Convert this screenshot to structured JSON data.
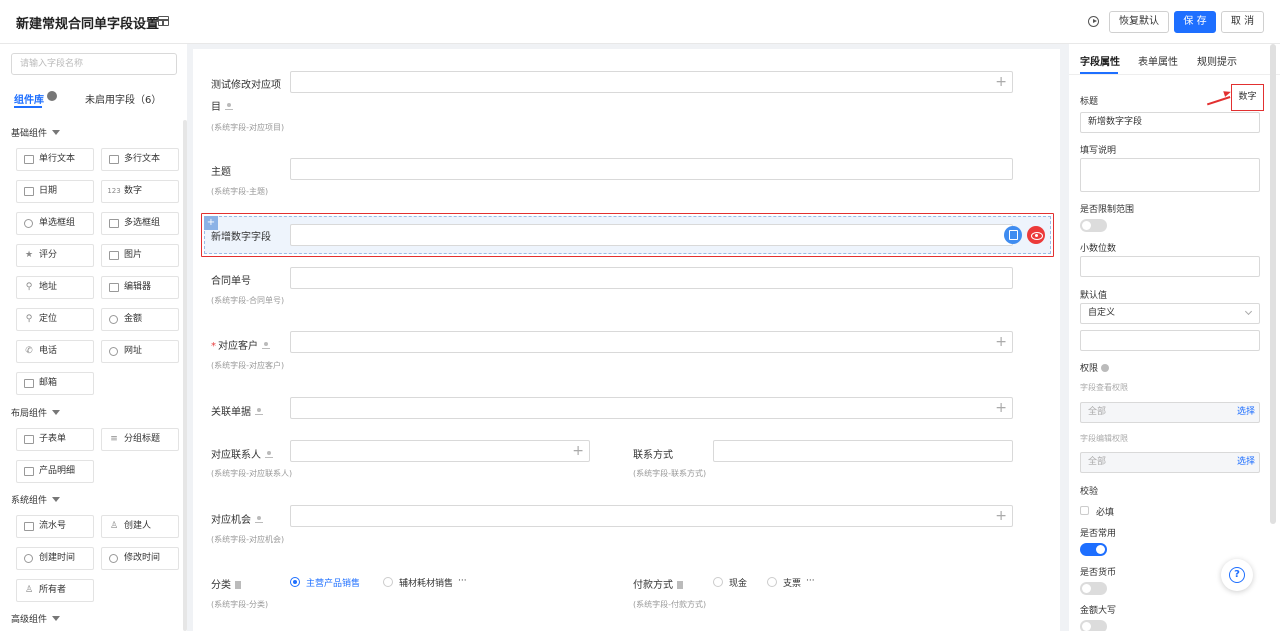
{
  "header": {
    "title": "新建常规合同单字段设置",
    "restore_label": "恢复默认",
    "save_label": "保 存",
    "cancel_label": "取 消"
  },
  "left_panel": {
    "search_placeholder": "请输入字段名称",
    "tabs": {
      "library": "组件库",
      "unused": "未启用字段（6）"
    },
    "groups": [
      {
        "title": "基础组件",
        "items": [
          {
            "label": "单行文本",
            "icon": "single-line-icon"
          },
          {
            "label": "多行文本",
            "icon": "multi-line-icon"
          },
          {
            "label": "日期",
            "icon": "calendar-icon"
          },
          {
            "label": "数字",
            "icon": "number-icon",
            "glyph": "123"
          },
          {
            "label": "单选框组",
            "icon": "radio-icon"
          },
          {
            "label": "多选框组",
            "icon": "checkbox-icon"
          },
          {
            "label": "评分",
            "icon": "star-icon",
            "glyph": "★"
          },
          {
            "label": "图片",
            "icon": "image-icon"
          },
          {
            "label": "地址",
            "icon": "location-icon",
            "glyph": "⚲"
          },
          {
            "label": "编辑器",
            "icon": "editor-icon"
          },
          {
            "label": "定位",
            "icon": "pin-icon",
            "glyph": "⚲"
          },
          {
            "label": "金额",
            "icon": "coin-icon"
          },
          {
            "label": "电话",
            "icon": "phone-icon",
            "glyph": "✆"
          },
          {
            "label": "网址",
            "icon": "link-icon"
          },
          {
            "label": "邮箱",
            "icon": "mail-icon"
          }
        ]
      },
      {
        "title": "布局组件",
        "items": [
          {
            "label": "子表单",
            "icon": "subform-icon"
          },
          {
            "label": "分组标题",
            "icon": "group-title-icon",
            "glyph": "≡"
          },
          {
            "label": "产品明细",
            "icon": "product-detail-icon"
          }
        ]
      },
      {
        "title": "系统组件",
        "items": [
          {
            "label": "流水号",
            "icon": "serial-icon"
          },
          {
            "label": "创建人",
            "icon": "user-icon",
            "glyph": "♙"
          },
          {
            "label": "创建时间",
            "icon": "clock-icon"
          },
          {
            "label": "修改时间",
            "icon": "clock-edit-icon"
          },
          {
            "label": "所有者",
            "icon": "owner-icon",
            "glyph": "♙"
          }
        ]
      },
      {
        "title": "高级组件",
        "items": []
      }
    ]
  },
  "form": {
    "fields": [
      {
        "label": "测试修改对应项",
        "label_line2": "目",
        "sub": "(系统字段-对应项目)"
      },
      {
        "label": "主题",
        "sub": "(系统字段-主题)"
      },
      {
        "label": "新增数字字段"
      },
      {
        "label": "合同单号",
        "sub": "(系统字段-合同单号)"
      },
      {
        "label": "对应客户",
        "required": "*",
        "sub": "(系统字段-对应客户)"
      },
      {
        "label": "关联单据"
      },
      {
        "label": "对应联系人",
        "sub": "(系统字段-对应联系人)"
      },
      {
        "label": "联系方式",
        "sub": "(系统字段-联系方式)"
      },
      {
        "label": "对应机会",
        "sub": "(系统字段-对应机会)"
      },
      {
        "label": "分类",
        "sub": "(系统字段-分类)",
        "options": [
          "主营产品销售",
          "辅材耗材销售"
        ],
        "selected": 0,
        "more": "···"
      },
      {
        "label": "付款方式",
        "sub": "(系统字段-付款方式)",
        "options": [
          "现金",
          "支票"
        ],
        "more": "···"
      }
    ]
  },
  "props": {
    "tabs": [
      "字段属性",
      "表单属性",
      "规则提示"
    ],
    "type_tag": "数字",
    "title_label": "标题",
    "title_value": "新增数字字段",
    "desc_label": "填写说明",
    "limit_label": "是否限制范围",
    "limit_on": false,
    "decimal_label": "小数位数",
    "decimal_value": "",
    "default_label": "默认值",
    "default_mode": "自定义",
    "default_value": "",
    "perm_label": "权限",
    "view_perm_label": "字段查看权限",
    "view_perm_value": "全部",
    "edit_perm_label": "字段编辑权限",
    "edit_perm_value": "全部",
    "choose_label": "选择",
    "validate_label": "校验",
    "required_label": "必填",
    "required_checked": false,
    "common_label": "是否常用",
    "common_on": true,
    "currency_label": "是否货币",
    "currency_on": false,
    "upper_label": "金额大写",
    "upper_on": false
  },
  "colors": {
    "primary": "#1e6fff",
    "annotation": "#e23030",
    "delete": "#ec3a3a"
  }
}
